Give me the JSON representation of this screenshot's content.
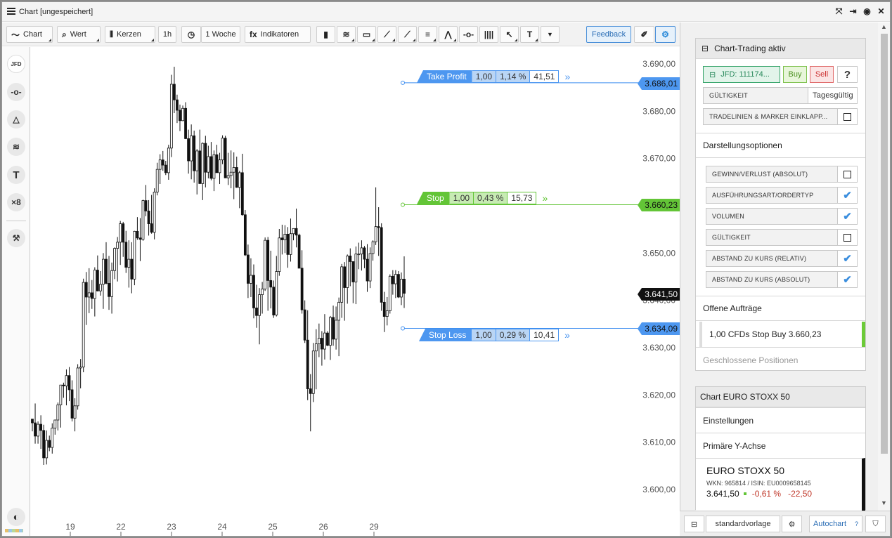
{
  "window": {
    "title": "Chart [ungespeichert]"
  },
  "toolbar": {
    "chart_label": "Chart",
    "wert_label": "Wert",
    "kerzen_label": "Kerzen",
    "interval_label": "1h",
    "range_label": "1 Woche",
    "fx_icon": "fx",
    "indikatoren_label": "Indikatoren",
    "feedback_label": "Feedback"
  },
  "leftbar": {
    "jfd_label": "JFD"
  },
  "chart": {
    "y_ticks": [
      "3.690,00",
      "3.680,00",
      "3.670,00",
      "3.660,00",
      "3.650,00",
      "3.640,00",
      "3.630,00",
      "3.620,00",
      "3.610,00",
      "3.600,00"
    ],
    "x_ticks": [
      "19",
      "22",
      "23",
      "24",
      "25",
      "26",
      "29"
    ],
    "last_price": "3.641,50",
    "orders": {
      "take_profit": {
        "name": "Take Profit",
        "qty": "1,00",
        "pct": "1,14 %",
        "dist": "41,51",
        "price": "3.686,01"
      },
      "stop": {
        "name": "Stop",
        "qty": "1,00",
        "pct": "0,43 %",
        "dist": "15,73",
        "price": "3.660,23"
      },
      "stop_loss": {
        "name": "Stop Loss",
        "qty": "1,00",
        "pct": "0,29 %",
        "dist": "10,41",
        "price": "3.634,09"
      }
    },
    "arrow_glyph": "»",
    "colors": {
      "blue": "#3d8ef0",
      "green": "#63c537",
      "black": "#111111"
    }
  },
  "chart_data": {
    "type": "candlestick",
    "ylim": [
      3595,
      3695
    ],
    "ohlc": [
      [
        3614.9,
        3614.9,
        3612.3,
        3614.1
      ],
      [
        3614.1,
        3618.2,
        3609.7,
        3611.3
      ],
      [
        3611.3,
        3614.4,
        3609.7,
        3613.8
      ],
      [
        3613.8,
        3615.7,
        3608.6,
        3612.5
      ],
      [
        3612.5,
        3613.7,
        3605.2,
        3606.7
      ],
      [
        3606.7,
        3612.5,
        3605.3,
        3610.4
      ],
      [
        3610.4,
        3611.4,
        3608.1,
        3608.9
      ],
      [
        3608.9,
        3614.0,
        3607.6,
        3613.0
      ],
      [
        3613.0,
        3614.8,
        3611.6,
        3614.7
      ],
      [
        3614.7,
        3618.4,
        3612.5,
        3617.9
      ],
      [
        3617.9,
        3622.1,
        3613.1,
        3622.1
      ],
      [
        3622.1,
        3622.6,
        3619.4,
        3621.9
      ],
      [
        3621.9,
        3625.4,
        3617.8,
        3624.1
      ],
      [
        3624.1,
        3625.9,
        3618.7,
        3621.1
      ],
      [
        3621.1,
        3623.1,
        3614.4,
        3615.1
      ],
      [
        3615.1,
        3619.3,
        3612.3,
        3617.7
      ],
      [
        3617.7,
        3626.5,
        3616.9,
        3625.7
      ],
      [
        3625.7,
        3627.6,
        3621.4,
        3625.9
      ],
      [
        3625.9,
        3644.6,
        3624.8,
        3643.8
      ],
      [
        3643.8,
        3646.0,
        3634.8,
        3640.7
      ],
      [
        3640.7,
        3646.8,
        3637.3,
        3641.6
      ],
      [
        3641.6,
        3644.3,
        3638.2,
        3640.4
      ],
      [
        3640.4,
        3647.0,
        3636.6,
        3646.4
      ],
      [
        3646.4,
        3649.5,
        3641.9,
        3642.0
      ],
      [
        3642.0,
        3646.2,
        3641.0,
        3643.4
      ],
      [
        3643.4,
        3650.0,
        3638.2,
        3648.7
      ],
      [
        3648.7,
        3652.3,
        3643.4,
        3643.6
      ],
      [
        3643.6,
        3649.4,
        3638.0,
        3640.8
      ],
      [
        3640.8,
        3648.0,
        3637.2,
        3646.3
      ],
      [
        3646.3,
        3651.2,
        3644.5,
        3651.0
      ],
      [
        3651.0,
        3653.4,
        3644.0,
        3652.3
      ],
      [
        3652.3,
        3656.8,
        3647.5,
        3656.2
      ],
      [
        3656.2,
        3656.6,
        3649.2,
        3652.3
      ],
      [
        3652.3,
        3654.7,
        3645.8,
        3647.0
      ],
      [
        3647.0,
        3652.7,
        3642.7,
        3648.7
      ],
      [
        3648.7,
        3652.3,
        3641.5,
        3644.5
      ],
      [
        3644.5,
        3654.7,
        3643.2,
        3654.6
      ],
      [
        3654.6,
        3657.6,
        3652.8,
        3653.2
      ],
      [
        3653.2,
        3657.4,
        3648.3,
        3652.9
      ],
      [
        3652.9,
        3661.3,
        3652.6,
        3661.1
      ],
      [
        3661.1,
        3664.4,
        3657.8,
        3658.9
      ],
      [
        3658.9,
        3661.2,
        3653.7,
        3656.2
      ],
      [
        3656.2,
        3662.3,
        3654.1,
        3654.4
      ],
      [
        3654.4,
        3663.7,
        3652.9,
        3662.9
      ],
      [
        3662.9,
        3669.1,
        3662.2,
        3667.7
      ],
      [
        3667.7,
        3670.9,
        3664.6,
        3669.7
      ],
      [
        3669.7,
        3671.6,
        3667.4,
        3668.6
      ],
      [
        3668.6,
        3669.5,
        3666.5,
        3667.0
      ],
      [
        3667.0,
        3672.9,
        3665.5,
        3672.2
      ],
      [
        3672.2,
        3687.7,
        3670.3,
        3685.7
      ],
      [
        3685.7,
        3689.4,
        3679.6,
        3682.4
      ],
      [
        3682.4,
        3683.5,
        3677.5,
        3680.2
      ],
      [
        3680.2,
        3681.4,
        3675.8,
        3678.0
      ],
      [
        3678.0,
        3681.2,
        3677.9,
        3680.6
      ],
      [
        3680.6,
        3681.9,
        3674.1,
        3674.2
      ],
      [
        3674.2,
        3676.1,
        3666.8,
        3669.5
      ],
      [
        3669.5,
        3677.2,
        3665.6,
        3674.8
      ],
      [
        3674.8,
        3675.9,
        3664.9,
        3667.4
      ],
      [
        3667.4,
        3672.0,
        3662.4,
        3671.6
      ],
      [
        3671.6,
        3676.1,
        3664.6,
        3664.7
      ],
      [
        3664.7,
        3673.4,
        3661.2,
        3673.2
      ],
      [
        3673.2,
        3674.8,
        3663.9,
        3667.1
      ],
      [
        3667.1,
        3672.7,
        3665.8,
        3670.4
      ],
      [
        3670.4,
        3673.5,
        3665.4,
        3665.8
      ],
      [
        3665.8,
        3671.7,
        3663.1,
        3670.8
      ],
      [
        3670.8,
        3672.9,
        3667.0,
        3667.0
      ],
      [
        3667.0,
        3671.2,
        3664.6,
        3669.7
      ],
      [
        3669.7,
        3674.9,
        3668.8,
        3674.3
      ],
      [
        3674.3,
        3674.8,
        3665.9,
        3665.9
      ],
      [
        3665.9,
        3671.2,
        3664.4,
        3666.4
      ],
      [
        3666.4,
        3671.7,
        3663.7,
        3667.1
      ],
      [
        3667.1,
        3671.3,
        3661.4,
        3668.1
      ],
      [
        3668.1,
        3670.4,
        3663.8,
        3663.9
      ],
      [
        3663.9,
        3667.4,
        3659.5,
        3667.0
      ],
      [
        3667.0,
        3671.0,
        3657.9,
        3658.1
      ],
      [
        3658.1,
        3659.1,
        3649.4,
        3649.6
      ],
      [
        3649.6,
        3651.8,
        3640.5,
        3643.6
      ],
      [
        3643.6,
        3648.9,
        3640.7,
        3645.3
      ],
      [
        3645.3,
        3647.6,
        3636.2,
        3638.4
      ],
      [
        3638.4,
        3643.3,
        3634.2,
        3636.8
      ],
      [
        3636.8,
        3642.6,
        3630.7,
        3641.2
      ],
      [
        3641.2,
        3643.9,
        3637.2,
        3642.4
      ],
      [
        3642.4,
        3653.3,
        3642.0,
        3652.7
      ],
      [
        3652.7,
        3653.4,
        3637.8,
        3644.2
      ],
      [
        3644.2,
        3650.5,
        3638.3,
        3642.8
      ],
      [
        3642.8,
        3644.2,
        3636.3,
        3636.9
      ],
      [
        3636.9,
        3649.4,
        3636.6,
        3646.1
      ],
      [
        3646.1,
        3655.1,
        3645.2,
        3653.2
      ],
      [
        3653.2,
        3656.0,
        3649.7,
        3652.8
      ],
      [
        3652.8,
        3655.9,
        3650.0,
        3654.0
      ],
      [
        3654.0,
        3655.5,
        3646.9,
        3649.7
      ],
      [
        3649.7,
        3657.3,
        3648.2,
        3654.1
      ],
      [
        3654.1,
        3655.2,
        3652.7,
        3655.2
      ],
      [
        3655.2,
        3659.4,
        3651.2,
        3653.8
      ],
      [
        3653.8,
        3654.1,
        3646.8,
        3646.8
      ],
      [
        3646.8,
        3650.6,
        3637.2,
        3638.0
      ],
      [
        3638.0,
        3640.0,
        3631.0,
        3631.6
      ],
      [
        3631.6,
        3637.9,
        3618.9,
        3621.3
      ],
      [
        3621.3,
        3624.4,
        3612.3,
        3620.3
      ],
      [
        3620.3,
        3631.0,
        3618.5,
        3629.3
      ],
      [
        3629.3,
        3633.9,
        3621.2,
        3630.8
      ],
      [
        3630.8,
        3635.1,
        3628.0,
        3632.0
      ],
      [
        3632.0,
        3633.5,
        3626.2,
        3629.7
      ],
      [
        3629.7,
        3637.1,
        3627.5,
        3633.1
      ],
      [
        3633.1,
        3633.5,
        3630.3,
        3630.5
      ],
      [
        3630.5,
        3636.7,
        3627.4,
        3636.4
      ],
      [
        3636.4,
        3638.9,
        3630.4,
        3631.8
      ],
      [
        3631.8,
        3638.7,
        3629.6,
        3635.8
      ],
      [
        3635.8,
        3640.6,
        3628.2,
        3639.6
      ],
      [
        3639.6,
        3647.7,
        3636.3,
        3647.1
      ],
      [
        3647.1,
        3648.1,
        3635.7,
        3642.7
      ],
      [
        3642.7,
        3649.7,
        3639.3,
        3649.4
      ],
      [
        3649.4,
        3651.0,
        3643.0,
        3648.2
      ],
      [
        3648.2,
        3648.2,
        3639.4,
        3643.9
      ],
      [
        3643.9,
        3651.4,
        3639.2,
        3649.8
      ],
      [
        3649.8,
        3652.2,
        3646.6,
        3649.8
      ],
      [
        3649.8,
        3652.7,
        3646.3,
        3651.1
      ],
      [
        3651.1,
        3651.5,
        3646.8,
        3648.7
      ],
      [
        3648.7,
        3651.9,
        3641.8,
        3644.1
      ],
      [
        3644.1,
        3651.2,
        3642.6,
        3649.9
      ],
      [
        3649.9,
        3652.7,
        3648.4,
        3652.4
      ],
      [
        3652.4,
        3663.9,
        3651.7,
        3655.6
      ],
      [
        3655.6,
        3659.7,
        3649.4,
        3655.4
      ],
      [
        3655.4,
        3656.3,
        3637.8,
        3639.6
      ],
      [
        3639.6,
        3641.8,
        3633.3,
        3636.6
      ],
      [
        3636.6,
        3640.7,
        3634.7,
        3637.8
      ],
      [
        3637.8,
        3645.5,
        3637.2,
        3645.1
      ],
      [
        3645.1,
        3646.4,
        3641.2,
        3643.5
      ],
      [
        3643.5,
        3646.4,
        3640.5,
        3645.5
      ],
      [
        3645.5,
        3646.2,
        3640.5,
        3640.7
      ],
      [
        3640.7,
        3645.9,
        3639.0,
        3644.5
      ],
      [
        3644.5,
        3649.3,
        3638.4,
        3641.5
      ]
    ]
  },
  "panel": {
    "trading_title": "Chart-Trading aktiv",
    "account": "JFD: 111174...",
    "buy": "Buy",
    "sell": "Sell",
    "help": "?",
    "gueltigkeit": "GÜLTIGKEIT",
    "gueltigkeit_value": "Tagesgültig",
    "tradelinien": "TRADELINIEN & MARKER EINKLAPP...",
    "darstellung_title": "Darstellungsoptionen",
    "options": [
      {
        "label": "GEWINN/VERLUST (ABSOLUT)",
        "checked": false
      },
      {
        "label": "AUSFÜHRUNGSART/ORDERTYP",
        "checked": true
      },
      {
        "label": "VOLUMEN",
        "checked": true
      },
      {
        "label": "GÜLTIGKEIT",
        "checked": false
      },
      {
        "label": "ABSTAND ZU KURS (RELATIV)",
        "checked": true
      },
      {
        "label": "ABSTAND ZU KURS (ABSOLUT)",
        "checked": true
      }
    ],
    "offene_title": "Offene Aufträge",
    "order_entry": "1,00 CFDs Stop Buy 3.660,23",
    "geschlossene": "Geschlossene Positionen",
    "chart_title": "Chart EURO STOXX 50",
    "einstellungen": "Einstellungen",
    "primaere": "Primäre Y-Achse",
    "instrument_name": "EURO STOXX 50",
    "instrument_ids": "WKN: 965814 / ISIN: EU0009658145",
    "instrument_price": "3.641,50",
    "instrument_pct": "-0,61 %",
    "instrument_abs": "-22,50"
  },
  "bottom": {
    "template": "standardvorlage",
    "autochart": "Autochart",
    "autochart_help": "?"
  }
}
